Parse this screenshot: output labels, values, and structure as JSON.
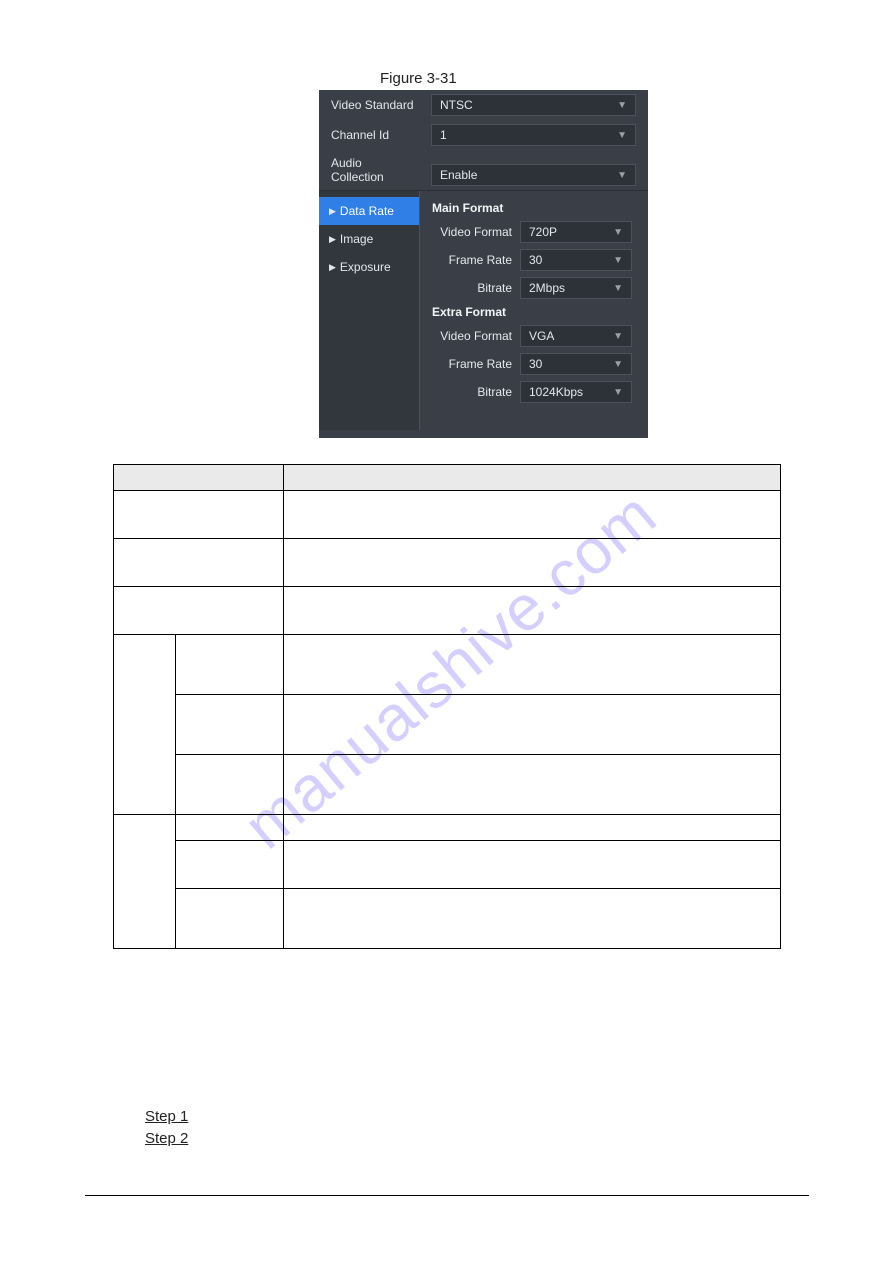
{
  "figure_caption": "Figure 3-31",
  "panel": {
    "video_standard_label": "Video Standard",
    "video_standard_value": "NTSC",
    "channel_id_label": "Channel Id",
    "channel_id_value": "1",
    "audio_collection_label_line1": "Audio",
    "audio_collection_label_line2": "Collection",
    "audio_collection_value": "Enable",
    "sidebar": {
      "items": [
        {
          "label": "Data Rate",
          "active": true
        },
        {
          "label": "Image",
          "active": false
        },
        {
          "label": "Exposure",
          "active": false
        }
      ]
    },
    "content": {
      "main_section": "Main Format",
      "main_video_format_label": "Video Format",
      "main_video_format_value": "720P",
      "main_frame_rate_label": "Frame Rate",
      "main_frame_rate_value": "30",
      "main_bitrate_label": "Bitrate",
      "main_bitrate_value": "2Mbps",
      "extra_section": "Extra Format",
      "extra_video_format_label": "Video Format",
      "extra_video_format_value": "VGA",
      "extra_frame_rate_label": "Frame Rate",
      "extra_frame_rate_value": "30",
      "extra_bitrate_label": "Bitrate",
      "extra_bitrate_value": "1024Kbps"
    }
  },
  "watermark": "manualshive.com",
  "steps": {
    "step1": "Step 1",
    "step2": "Step 2"
  }
}
